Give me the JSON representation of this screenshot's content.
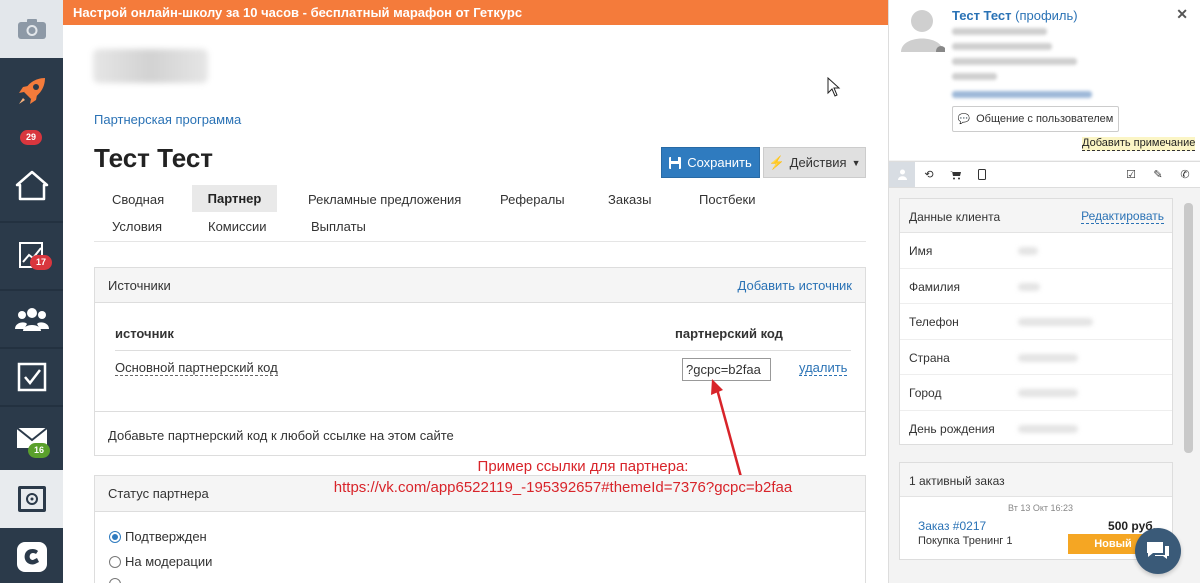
{
  "banner": {
    "text": "Настрой онлайн-школу за 10 часов - бесплатный марафон от Геткурс"
  },
  "sidebar": {
    "badges": {
      "rocket": "29",
      "stats": "17",
      "mail": "16"
    }
  },
  "breadcrumb": "Партнерская программа",
  "page_title": "Тест Тест",
  "buttons": {
    "save": "Сохранить",
    "actions": "Действия"
  },
  "tabs": {
    "row1": [
      "Сводная",
      "Партнер",
      "Рекламные предложения",
      "Рефералы",
      "Заказы",
      "Постбеки"
    ],
    "row2": [
      "Условия",
      "Комиссии",
      "Выплаты"
    ],
    "active": "Партнер"
  },
  "sources": {
    "title": "Источники",
    "add_link": "Добавить источник",
    "col_source": "источник",
    "col_code": "партнерский код",
    "rows": [
      {
        "name": "Основной партнерский код",
        "code": "?gcpc=b2faa",
        "delete": "удалить"
      }
    ],
    "hint": "Добавьте партнерский код к любой ссылке на этом сайте"
  },
  "annotation": {
    "line1": "Пример ссылки для партнера:",
    "line2": "https://vk.com/app6522119_-195392657#themeId=7376?gcpc=b2faa"
  },
  "status": {
    "title": "Статус партнера",
    "options": [
      {
        "label": "Подтвержден",
        "checked": true
      },
      {
        "label": "На модерации",
        "checked": false
      }
    ]
  },
  "user": {
    "name": "Тест Тест",
    "profile_link": "(профиль)",
    "chat_button": "Общение с пользователем",
    "add_note": "Добавить примечание"
  },
  "client_data": {
    "title": "Данные клиента",
    "edit": "Редактировать",
    "fields": [
      "Имя",
      "Фамилия",
      "Телефон",
      "Страна",
      "Город",
      "День рождения"
    ]
  },
  "orders": {
    "title": "1 активный заказ",
    "date": "Вт 13 Окт 16:23",
    "order_link": "Заказ #0217",
    "price": "500 руб.",
    "product": "Покупка Тренинг 1",
    "status": "Новый"
  },
  "colors": {
    "accent": "#2f7bbf",
    "banner": "#f47b3b",
    "sidebar": "#2b3a4a",
    "status_new": "#f5a623",
    "annotation": "#d8242a"
  }
}
